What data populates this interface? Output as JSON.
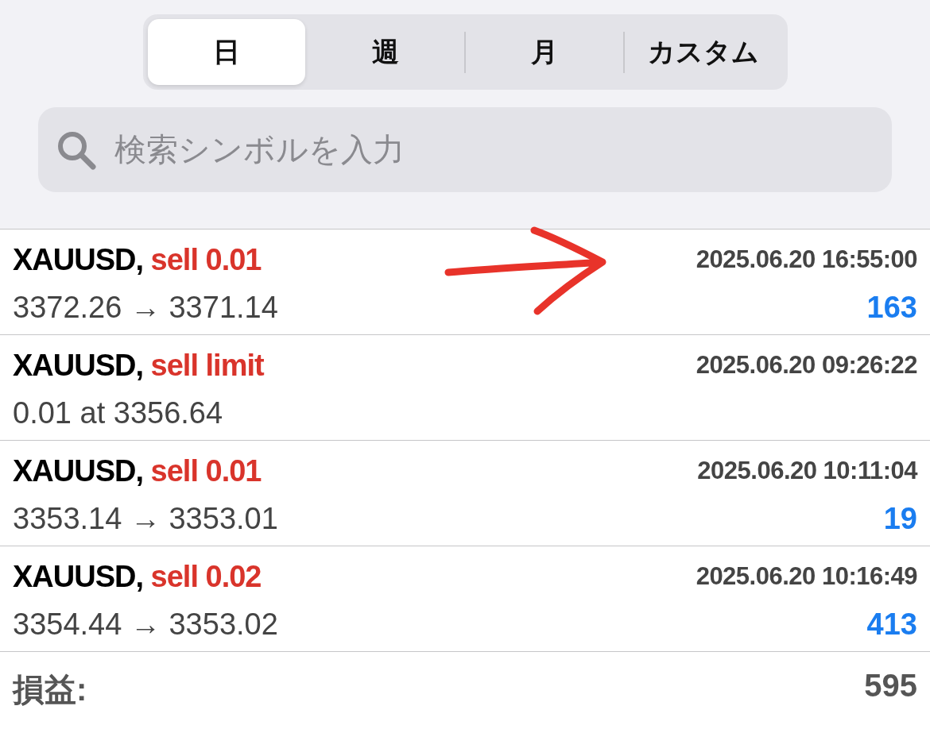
{
  "tabs": [
    {
      "label": "日",
      "selected": true
    },
    {
      "label": "週",
      "selected": false
    },
    {
      "label": "月",
      "selected": false
    },
    {
      "label": "カスタム",
      "selected": false
    }
  ],
  "search": {
    "placeholder": "検索シンボルを入力"
  },
  "trades": [
    {
      "symbol": "XAUUSD,",
      "side": "sell 0.01",
      "time": "2025.06.20 16:55:00",
      "detail": "3372.26 → 3371.14",
      "profit": "163"
    },
    {
      "symbol": "XAUUSD,",
      "side": "sell limit",
      "time": "2025.06.20 09:26:22",
      "detail": "0.01 at 3356.64"
    },
    {
      "symbol": "XAUUSD,",
      "side": "sell 0.01",
      "time": "2025.06.20 10:11:04",
      "detail": "3353.14 → 3353.01",
      "profit": "19"
    },
    {
      "symbol": "XAUUSD,",
      "side": "sell 0.02",
      "time": "2025.06.20 10:16:49",
      "detail": "3354.44 → 3353.02",
      "profit": "413"
    }
  ],
  "total": {
    "label": "損益:",
    "value": "595"
  }
}
